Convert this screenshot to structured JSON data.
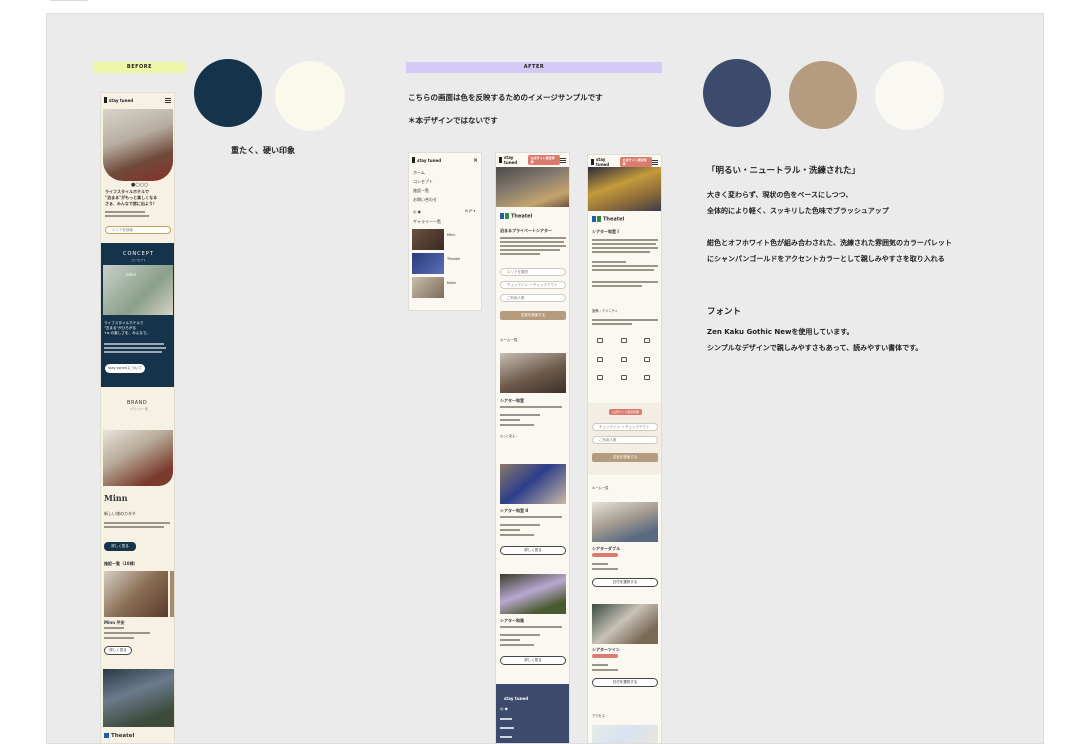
{
  "before": {
    "tag": "BEFORE",
    "swatch_colors": [
      "#15334a",
      "#fbf8ec"
    ],
    "caption": "重たく、硬い印象",
    "phone": {
      "brand": "stay tuned",
      "headline": "ライフスタイルホテルで\n\"泊まる\"がもっと楽しくなる\nさぁ、みんなで旅に出よう！",
      "search_placeholder": "エリアを検索",
      "concept_title": "CONCEPT",
      "concept_sub": "コンセプト",
      "minn_label": "minn",
      "concept_text": "ライフスタイルホテルで\n\"泊まる\"がひろがる\n+α の楽しさを、みんなで。",
      "concept_button": "stay tuned について",
      "brand_title": "BRAND",
      "brand_sub": "ブランド一覧",
      "minn_logo": "Minn",
      "minn_caption": "新しい旅のカタチ",
      "minn_button": "詳しく見る",
      "facilities_title": "施設一覧（10棟）",
      "facility_name": "Minn 平安",
      "facility_button": "詳しく見る",
      "theatel_label": "Theatel"
    }
  },
  "after": {
    "tag": "AFTER",
    "swatch_colors": [
      "#3c4a6b",
      "#b59c7e",
      "#faf8f2"
    ],
    "note_1": "こちらの画面は色を反映するためのイメージサンプルです",
    "note_2": "＊本デザインではないです",
    "quote": "「明るい・ニュートラル・洗練された」",
    "desc_1": "大きく変わらず、現状の色をベースにしつつ、",
    "desc_2": "全体的により軽く、スッキリした色味でブラッシュアップ",
    "desc_3": "紺色とオフホワイト色が組み合わされた、洗練された雰囲気のカラーパレット",
    "desc_4": "にシャンパンゴールドをアクセントカラーとして親しみやすさを取り入れる",
    "font_heading": "フォント",
    "font_1": "Zen Kaku Gothic Newを使用しています。",
    "font_2": "シンプルなデザインで親しみやすさもあって、読みやすい書体です。",
    "menu_phone": {
      "brand": "stay tuned",
      "items": [
        "ホーム",
        "コンセプト",
        "施設一覧",
        "お問い合わせ"
      ],
      "section": "ギャラリー一覧",
      "rows": [
        "Minn",
        "Theatel",
        "Nohn"
      ]
    },
    "phone_2": {
      "brand": "stay tuned",
      "badge": "公式サイト限定特典",
      "theatel": "Theatel",
      "headline": "泊まるプライベートシアター",
      "field_1": "エリアを選択",
      "field_2": "チェックイン → チェックアウト",
      "field_3": "ご利用人数",
      "submit": "空室を検索する",
      "section": "ルーム一覧",
      "room_1": "シアター和室",
      "room_2": "シアター和室 II",
      "room_3": "シアター和風",
      "more": "詳しく見る",
      "footer_brand": "stay tuned"
    },
    "phone_3": {
      "brand": "stay tuned",
      "badge": "公式サイト限定特典",
      "theatel": "Theatel",
      "headline": "シアター和室 I",
      "amenity_section": "設備・アメニティ",
      "badge_2": "公式サイト限定特典",
      "field_1": "チェックイン → チェックアウト",
      "field_2": "ご利用人数",
      "submit": "空室を検索する",
      "section": "ルーム一覧",
      "room_1": "シアターダブル",
      "room_2": "シアターツイン",
      "select": "日付を選択する",
      "map_label": "アクセス"
    }
  }
}
